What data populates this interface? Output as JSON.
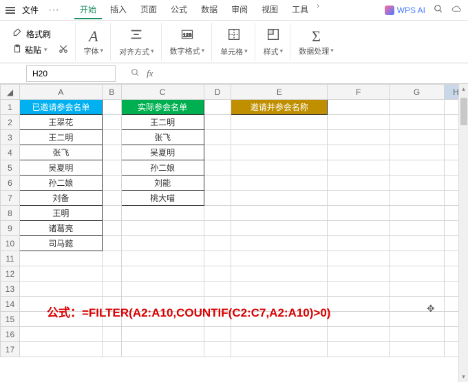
{
  "menu": {
    "file": "文件",
    "more": "···",
    "tabs": [
      "开始",
      "插入",
      "页面",
      "公式",
      "数据",
      "审阅",
      "视图",
      "工具"
    ],
    "active_tab": "开始",
    "wps_ai": "WPS AI"
  },
  "toolbar": {
    "format_painter": "格式刷",
    "paste": "粘贴",
    "font": "字体",
    "align": "对齐方式",
    "number_format": "数字格式",
    "cell_format": "单元格",
    "style": "样式",
    "data_process": "数据处理"
  },
  "address": {
    "cell_ref": "H20",
    "fx": "fx",
    "formula_value": ""
  },
  "columns": [
    "A",
    "B",
    "C",
    "D",
    "E",
    "F",
    "G",
    "H"
  ],
  "rows": [
    "1",
    "2",
    "3",
    "4",
    "5",
    "6",
    "7",
    "8",
    "9",
    "10",
    "11",
    "12",
    "13",
    "14",
    "15",
    "16",
    "17"
  ],
  "headers": {
    "invited": "已邀请参会名单",
    "actual": "实际参会名单",
    "result": "邀请并参会名称"
  },
  "invited_list": [
    "王翠花",
    "王二明",
    "张飞",
    "吴夏明",
    "孙二娘",
    "刘备",
    "王明",
    "诸葛亮",
    "司马懿"
  ],
  "actual_list": [
    "王二明",
    "张飞",
    "吴夏明",
    "孙二娘",
    "刘能",
    "桃大喵"
  ],
  "formula_display": {
    "prefix": "公式：",
    "body": "=FILTER(A2:A10,COUNTIF(C2:C7,A2:A10)>0)"
  },
  "chart_data": {
    "type": "table",
    "title": "",
    "columns": [
      "已邀请参会名单",
      "实际参会名单",
      "邀请并参会名称"
    ],
    "series": [
      {
        "name": "已邀请参会名单",
        "values": [
          "王翠花",
          "王二明",
          "张飞",
          "吴夏明",
          "孙二娘",
          "刘备",
          "王明",
          "诸葛亮",
          "司马懿"
        ]
      },
      {
        "name": "实际参会名单",
        "values": [
          "王二明",
          "张飞",
          "吴夏明",
          "孙二娘",
          "刘能",
          "桃大喵"
        ]
      },
      {
        "name": "邀请并参会名称",
        "values": []
      }
    ],
    "formula": "=FILTER(A2:A10,COUNTIF(C2:C7,A2:A10)>0)"
  }
}
